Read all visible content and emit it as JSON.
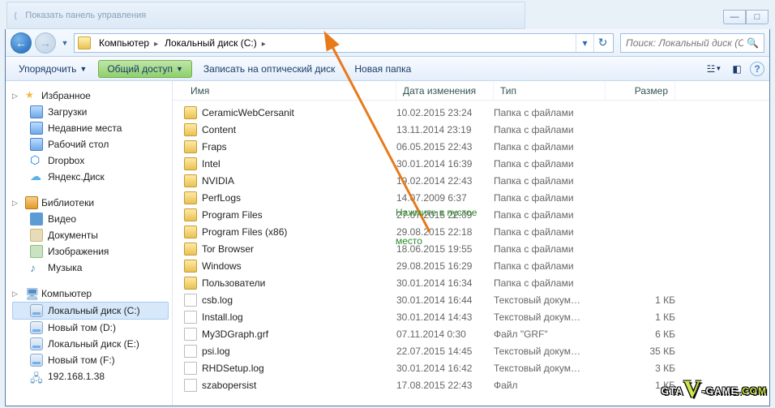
{
  "ghost_hint": "Показать панель управления",
  "chrome": {
    "min": "—",
    "max": "□",
    "close": "✕"
  },
  "breadcrumb": {
    "root": "Компьютер",
    "drive": "Локальный диск (C:)"
  },
  "search_placeholder": "Поиск: Локальный диск (C:)",
  "toolbar": {
    "organize": "Упорядочить",
    "share": "Общий доступ",
    "burn": "Записать на оптический диск",
    "newfolder": "Новая папка"
  },
  "sidebar": {
    "favorites": {
      "label": "Избранное",
      "items": [
        {
          "label": "Загрузки",
          "ico": "i-bluefolder"
        },
        {
          "label": "Недавние места",
          "ico": "i-bluefolder"
        },
        {
          "label": "Рабочий стол",
          "ico": "i-bluefolder"
        },
        {
          "label": "Dropbox",
          "ico": "i-dropbox"
        },
        {
          "label": "Яндекс.Диск",
          "ico": "i-ydisk"
        }
      ]
    },
    "libraries": {
      "label": "Библиотеки",
      "items": [
        {
          "label": "Видео",
          "ico": "i-video"
        },
        {
          "label": "Документы",
          "ico": "i-doc"
        },
        {
          "label": "Изображения",
          "ico": "i-img"
        },
        {
          "label": "Музыка",
          "ico": "i-music"
        }
      ]
    },
    "computer": {
      "label": "Компьютер",
      "items": [
        {
          "label": "Локальный диск (C:)",
          "ico": "i-drive",
          "selected": true
        },
        {
          "label": "Новый том (D:)",
          "ico": "i-drive"
        },
        {
          "label": "Локальный диск (E:)",
          "ico": "i-drive"
        },
        {
          "label": "Новый том (F:)",
          "ico": "i-drive"
        },
        {
          "label": "192.168.1.38",
          "ico": "i-net"
        }
      ]
    }
  },
  "columns": {
    "name": "Имя",
    "date": "Дата изменения",
    "type": "Тип",
    "size": "Размер"
  },
  "files": [
    {
      "name": "CeramicWebCersanit",
      "date": "10.02.2015 23:24",
      "type": "Папка с файлами",
      "size": "",
      "ico": "i-folder"
    },
    {
      "name": "Content",
      "date": "13.11.2014 23:19",
      "type": "Папка с файлами",
      "size": "",
      "ico": "i-folder"
    },
    {
      "name": "Fraps",
      "date": "06.05.2015 22:43",
      "type": "Папка с файлами",
      "size": "",
      "ico": "i-folder"
    },
    {
      "name": "Intel",
      "date": "30.01.2014 16:39",
      "type": "Папка с файлами",
      "size": "",
      "ico": "i-folder"
    },
    {
      "name": "NVIDIA",
      "date": "19.02.2014 22:43",
      "type": "Папка с файлами",
      "size": "",
      "ico": "i-folder"
    },
    {
      "name": "PerfLogs",
      "date": "14.07.2009 6:37",
      "type": "Папка с файлами",
      "size": "",
      "ico": "i-folder"
    },
    {
      "name": "Program Files",
      "date": "27.07.2015 22:09",
      "type": "Папка с файлами",
      "size": "",
      "ico": "i-folder"
    },
    {
      "name": "Program Files (x86)",
      "date": "29.08.2015 22:18",
      "type": "Папка с файлами",
      "size": "",
      "ico": "i-folder"
    },
    {
      "name": "Tor Browser",
      "date": "18.06.2015 19:55",
      "type": "Папка с файлами",
      "size": "",
      "ico": "i-folder"
    },
    {
      "name": "Windows",
      "date": "29.08.2015 16:29",
      "type": "Папка с файлами",
      "size": "",
      "ico": "i-folder"
    },
    {
      "name": "Пользователи",
      "date": "30.01.2014 16:34",
      "type": "Папка с файлами",
      "size": "",
      "ico": "i-folder"
    },
    {
      "name": "csb.log",
      "date": "30.01.2014 16:44",
      "type": "Текстовый докум…",
      "size": "1 КБ",
      "ico": "i-file"
    },
    {
      "name": "Install.log",
      "date": "30.01.2014 14:43",
      "type": "Текстовый докум…",
      "size": "1 КБ",
      "ico": "i-file"
    },
    {
      "name": "My3DGraph.grf",
      "date": "07.11.2014 0:30",
      "type": "Файл \"GRF\"",
      "size": "6 КБ",
      "ico": "i-file"
    },
    {
      "name": "psi.log",
      "date": "22.07.2015 14:45",
      "type": "Текстовый докум…",
      "size": "35 КБ",
      "ico": "i-file"
    },
    {
      "name": "RHDSetup.log",
      "date": "30.01.2014 16:42",
      "type": "Текстовый докум…",
      "size": "3 КБ",
      "ico": "i-file"
    },
    {
      "name": "szabopersist",
      "date": "17.08.2015 22:43",
      "type": "Файл",
      "size": "1 КБ",
      "ico": "i-file"
    }
  ],
  "annotation": {
    "line1": "Нажмите в пустое",
    "line2": "место"
  },
  "watermark": {
    "a": "GTA",
    "v": "V",
    "b": "-GAME",
    "c": ".COM"
  }
}
